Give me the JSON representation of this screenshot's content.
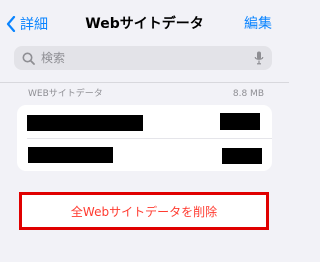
{
  "nav": {
    "back_label": "詳細",
    "title": "Webサイトデータ",
    "edit_label": "編集"
  },
  "search": {
    "placeholder": "検索",
    "value": ""
  },
  "section": {
    "header": "WEBサイトデータ",
    "total_size": "8.8 MB"
  },
  "action": {
    "delete_all_label": "全Webサイトデータを削除"
  },
  "colors": {
    "accent": "#0a84ff",
    "destructive": "#ff3b30",
    "highlight_box": "#e00000",
    "background": "#f2f2f7"
  },
  "icons": {
    "back": "chevron-left-icon",
    "search": "search-icon",
    "mic": "microphone-icon"
  }
}
